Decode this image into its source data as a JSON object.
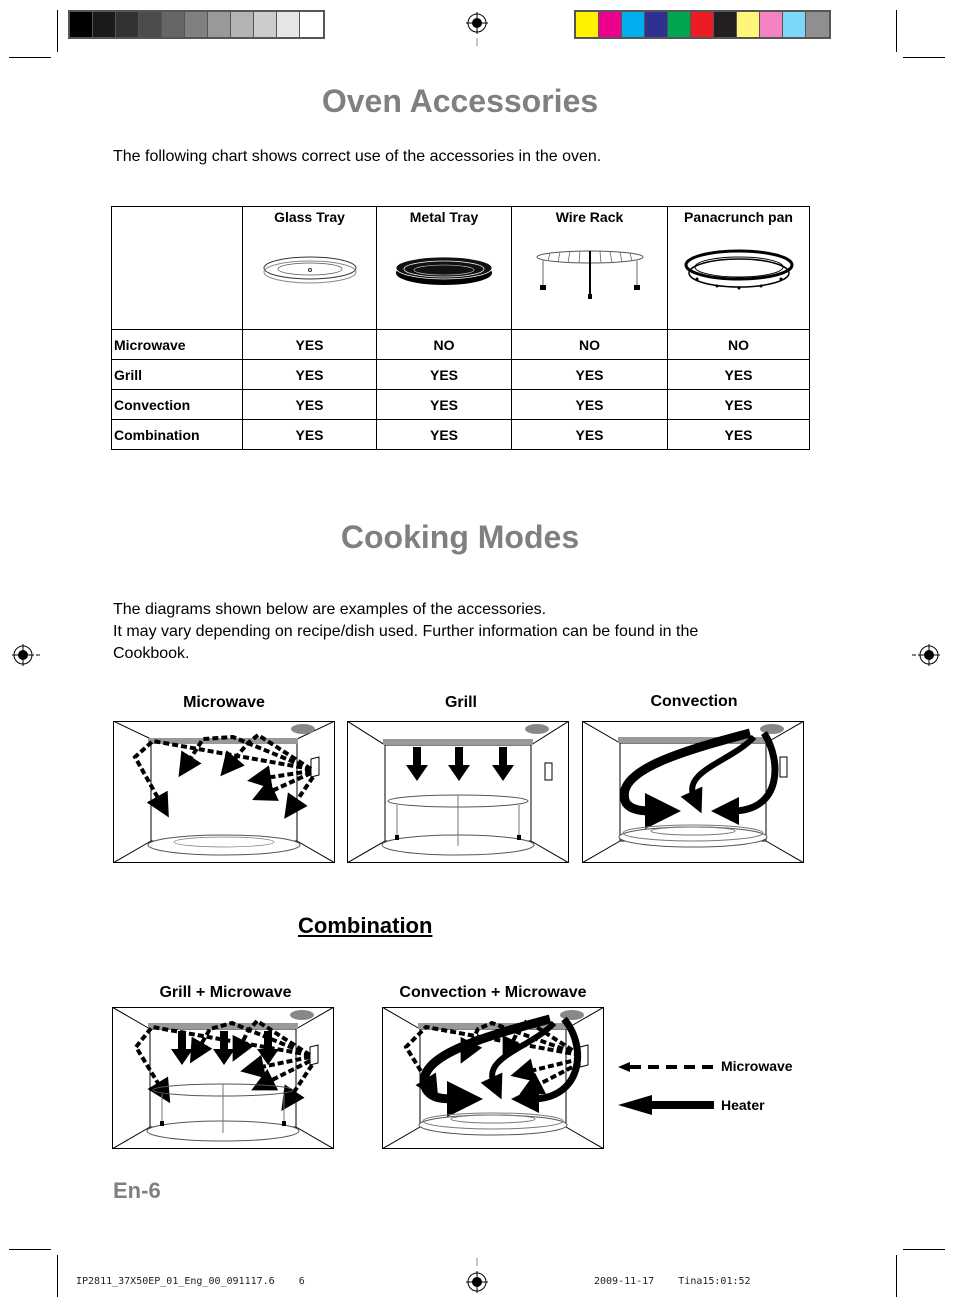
{
  "print_marks": {
    "grayscale_swatches": [
      "#000000",
      "#1b1b1b",
      "#333333",
      "#4c4c4c",
      "#666666",
      "#808080",
      "#999999",
      "#b3b3b3",
      "#cccccc",
      "#e6e6e6",
      "#ffffff"
    ],
    "color_swatches": [
      "#fff200",
      "#ec008c",
      "#00aeef",
      "#2e3192",
      "#00a651",
      "#ed1c24",
      "#231f20",
      "#fff57a",
      "#f582c1",
      "#7dd8f7",
      "#8f8f8f"
    ]
  },
  "oven_accessories": {
    "title": "Oven Accessories",
    "intro": "The following chart shows correct use of the accessories in the oven.",
    "table": {
      "columns": [
        "Glass Tray",
        "Metal Tray",
        "Wire Rack",
        "Panacrunch pan"
      ],
      "column_icons": [
        "glass-tray-icon",
        "metal-tray-icon",
        "wire-rack-icon",
        "panacrunch-pan-icon"
      ],
      "rows": [
        {
          "mode": "Microwave",
          "values": [
            "YES",
            "NO",
            "NO",
            "NO"
          ]
        },
        {
          "mode": "Grill",
          "values": [
            "YES",
            "YES",
            "YES",
            "YES"
          ]
        },
        {
          "mode": "Convection",
          "values": [
            "YES",
            "YES",
            "YES",
            "YES"
          ]
        },
        {
          "mode": "Combination",
          "values": [
            "YES",
            "YES",
            "YES",
            "YES"
          ]
        }
      ]
    }
  },
  "cooking_modes": {
    "title": "Cooking Modes",
    "intro_line1": "The diagrams shown below are examples of the accessories.",
    "intro_line2": "It may vary depending on recipe/dish used. Further information can be found in the",
    "intro_line3": "Cookbook.",
    "modes": [
      {
        "label": "Microwave"
      },
      {
        "label": "Grill"
      },
      {
        "label": "Convection"
      }
    ],
    "combination": {
      "title": "Combination",
      "modes": [
        {
          "label": "Grill + Microwave"
        },
        {
          "label": "Convection + Microwave"
        }
      ]
    },
    "legend": [
      {
        "label": "Microwave",
        "style": "dashed arrow"
      },
      {
        "label": "Heater",
        "style": "solid arrow"
      }
    ]
  },
  "page_number": "En-6",
  "footer": {
    "left": "IP2811_37X50EP_01_Eng_00_091117.6    6",
    "right": "2009-11-17    Tina15:01:52"
  }
}
